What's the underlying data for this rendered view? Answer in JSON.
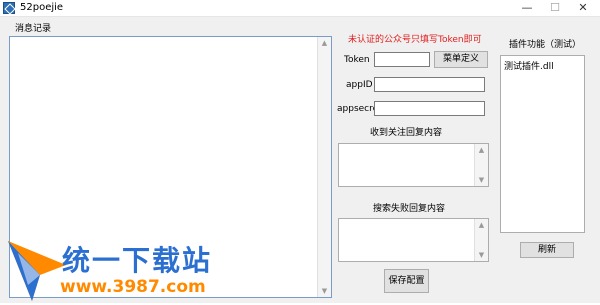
{
  "window": {
    "title": "52poejie",
    "icon": "app-icon",
    "min_glyph": "—",
    "max_glyph": "☐",
    "close_glyph": "✕"
  },
  "messages": {
    "label": "消息记录"
  },
  "notice": {
    "text": "未认证的公众号只填写Token即可",
    "color": "#e02020"
  },
  "form": {
    "token_label": "Token",
    "token_value": "",
    "menu_button": "菜单定义",
    "appid_label": "appID",
    "appid_value": "",
    "appsecret_label": "appsecret",
    "appsecret_value": "",
    "follow_reply_label": "收到关注回复内容",
    "search_fail_label": "搜索失败回复内容",
    "save_button": "保存配置"
  },
  "plugins": {
    "label": "插件功能（测试）",
    "items": [
      "测试插件.dll"
    ],
    "refresh_button": "刷新"
  },
  "watermark": {
    "text_cn": "统一下载站",
    "text_url": "www.3987.com"
  }
}
